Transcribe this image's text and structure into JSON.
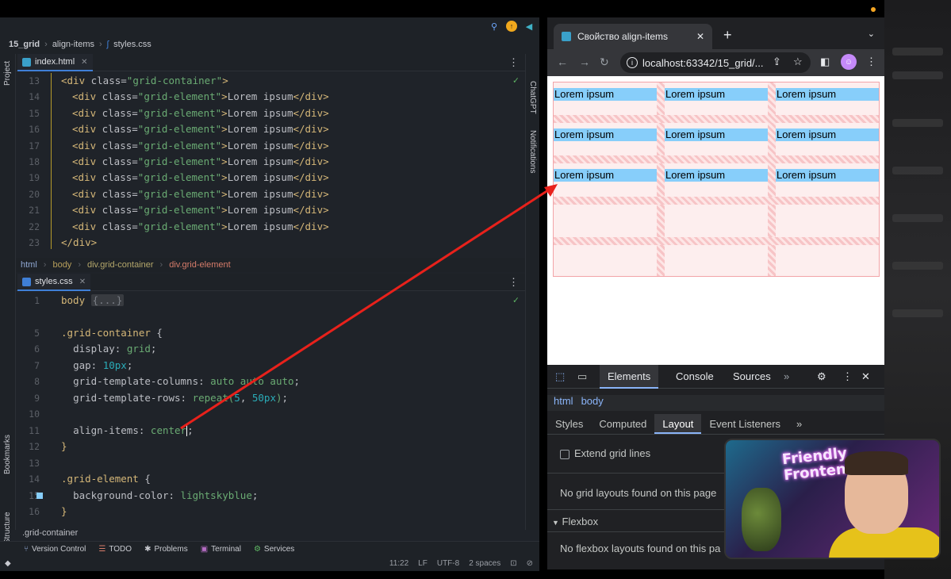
{
  "ide": {
    "breadcrumb": [
      "15_grid",
      "align-items",
      "styles.css"
    ],
    "left_tools": [
      "Project",
      "Bookmarks",
      "Structure"
    ],
    "right_tools": [
      "ChatGPT",
      "Notifications"
    ],
    "html_tab": "index.html",
    "css_tab": "styles.css",
    "html_lines": [
      {
        "n": "13",
        "open": "<div",
        "attr": " class=",
        "str": "\"grid-container\"",
        "close": ">",
        "text": "",
        "end": ""
      },
      {
        "n": "14",
        "open": "<div",
        "attr": " class=",
        "str": "\"grid-element\"",
        "close": ">",
        "text": "Lorem ipsum",
        "end": "</div>"
      },
      {
        "n": "15",
        "open": "<div",
        "attr": " class=",
        "str": "\"grid-element\"",
        "close": ">",
        "text": "Lorem ipsum",
        "end": "</div>"
      },
      {
        "n": "16",
        "open": "<div",
        "attr": " class=",
        "str": "\"grid-element\"",
        "close": ">",
        "text": "Lorem ipsum",
        "end": "</div>"
      },
      {
        "n": "17",
        "open": "<div",
        "attr": " class=",
        "str": "\"grid-element\"",
        "close": ">",
        "text": "Lorem ipsum",
        "end": "</div>"
      },
      {
        "n": "18",
        "open": "<div",
        "attr": " class=",
        "str": "\"grid-element\"",
        "close": ">",
        "text": "Lorem ipsum",
        "end": "</div>"
      },
      {
        "n": "19",
        "open": "<div",
        "attr": " class=",
        "str": "\"grid-element\"",
        "close": ">",
        "text": "Lorem ipsum",
        "end": "</div>"
      },
      {
        "n": "20",
        "open": "<div",
        "attr": " class=",
        "str": "\"grid-element\"",
        "close": ">",
        "text": "Lorem ipsum",
        "end": "</div>"
      },
      {
        "n": "21",
        "open": "<div",
        "attr": " class=",
        "str": "\"grid-element\"",
        "close": ">",
        "text": "Lorem ipsum",
        "end": "</div>"
      },
      {
        "n": "22",
        "open": "<div",
        "attr": " class=",
        "str": "\"grid-element\"",
        "close": ">",
        "text": "Lorem ipsum",
        "end": "</div>"
      },
      {
        "n": "23",
        "open": "</div",
        "attr": "",
        "str": "",
        "close": ">",
        "text": "",
        "end": ""
      }
    ],
    "html_crumbs": [
      "html",
      "body",
      "div.grid-container",
      "div.grid-element"
    ],
    "css": {
      "l1": {
        "n": "1",
        "sel": "body ",
        "fold": "{...}"
      },
      "l4": {
        "n": "4"
      },
      "l5": {
        "n": "5",
        "sel": ".grid-container ",
        "brace": "{"
      },
      "l6": {
        "n": "6",
        "prop": "display",
        "val": "grid"
      },
      "l7": {
        "n": "7",
        "prop": "gap",
        "val": "10px"
      },
      "l8": {
        "n": "8",
        "prop": "grid-template-columns",
        "val": "auto auto auto"
      },
      "l9": {
        "n": "9",
        "prop": "grid-template-rows",
        "fn": "repeat(",
        "num": "5",
        "sep": ", ",
        "num2": "50px",
        "end": ")"
      },
      "l10": {
        "n": "10"
      },
      "l11": {
        "n": "11",
        "prop": "align-items",
        "val": "center"
      },
      "l12": {
        "n": "12",
        "brace": "}"
      },
      "l13": {
        "n": "13"
      },
      "l14": {
        "n": "14",
        "sel": ".grid-element ",
        "brace": "{"
      },
      "l15": {
        "n": "15",
        "prop": "background-color",
        "val": "lightskyblue"
      },
      "l16": {
        "n": "16",
        "brace": "}"
      }
    },
    "css_crumb": ".grid-container",
    "tool_buttons": [
      "Version Control",
      "TODO",
      "Problems",
      "Terminal",
      "Services"
    ],
    "status": {
      "pos": "11:22",
      "sep": "LF",
      "enc": "UTF-8",
      "indent": "2 spaces"
    }
  },
  "browser": {
    "tab_title": "Свойство align-items",
    "url": "localhost:63342/15_grid/...",
    "cell_text": "Lorem ipsum",
    "devtools": {
      "tabs": [
        "Elements",
        "Console",
        "Sources"
      ],
      "crumbs": [
        "html",
        "body"
      ],
      "subtabs": [
        "Styles",
        "Computed",
        "Layout",
        "Event Listeners"
      ],
      "extend_grid": "Extend grid lines",
      "no_grid": "No grid layouts found on this page",
      "flexbox": "Flexbox",
      "no_flex": "No flexbox layouts found on this pa"
    }
  },
  "webcam": {
    "sign": "Friendly Frontend"
  },
  "colors": {
    "arrow": "#e8211b",
    "cell": "#87cefa",
    "accent": "#8ab4f8"
  }
}
